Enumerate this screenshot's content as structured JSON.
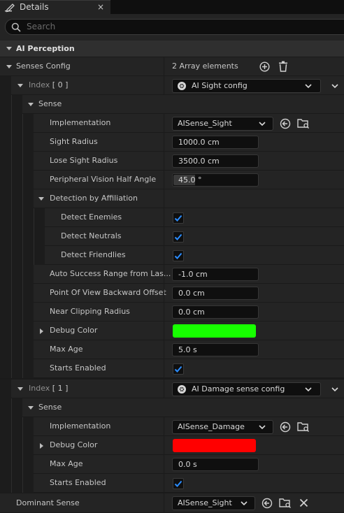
{
  "tab": {
    "title": "Details",
    "close": "×"
  },
  "search": {
    "placeholder": "Search"
  },
  "category": {
    "label": "AI Perception"
  },
  "senses_config": {
    "label": "Senses Config",
    "value": "2 Array elements",
    "index0": {
      "label": "Index",
      "num": "[ 0 ]",
      "combo": "AI Sight config",
      "sense_label": "Sense",
      "implementation": {
        "label": "Implementation",
        "value": "AISense_Sight"
      },
      "sight_radius": {
        "label": "Sight Radius",
        "value": "1000.0 cm"
      },
      "lose_sight_radius": {
        "label": "Lose Sight Radius",
        "value": "3500.0 cm"
      },
      "peripheral": {
        "label": "Peripheral Vision Half Angle",
        "value": "45.0 °",
        "fill": 0.25
      },
      "detection": {
        "label": "Detection by Affiliation",
        "enemies": {
          "label": "Detect Enemies",
          "checked": true
        },
        "neutrals": {
          "label": "Detect Neutrals",
          "checked": true
        },
        "friendlies": {
          "label": "Detect Friendlies",
          "checked": true
        }
      },
      "auto_success": {
        "label": "Auto Success Range from Las...",
        "value": "-1.0 cm"
      },
      "pov_offset": {
        "label": "Point Of View Backward Offset",
        "value": "0.0 cm"
      },
      "near_clip": {
        "label": "Near Clipping Radius",
        "value": "0.0 cm"
      },
      "debug_color": {
        "label": "Debug Color",
        "color": "#17ff00"
      },
      "max_age": {
        "label": "Max Age",
        "value": "5.0 s"
      },
      "starts_enabled": {
        "label": "Starts Enabled",
        "checked": true
      }
    },
    "index1": {
      "label": "Index",
      "num": "[ 1 ]",
      "combo": "AI Damage sense config",
      "sense_label": "Sense",
      "implementation": {
        "label": "Implementation",
        "value": "AISense_Damage"
      },
      "debug_color": {
        "label": "Debug Color",
        "color": "#ff0000"
      },
      "max_age": {
        "label": "Max Age",
        "value": "0.0 s"
      },
      "starts_enabled": {
        "label": "Starts Enabled",
        "checked": true
      }
    }
  },
  "dominant_sense": {
    "label": "Dominant Sense",
    "value": "AISense_Sight"
  },
  "colors": {
    "accent_check": "#2a8cff",
    "panel": "#242424",
    "field": "#0f0f0f"
  }
}
